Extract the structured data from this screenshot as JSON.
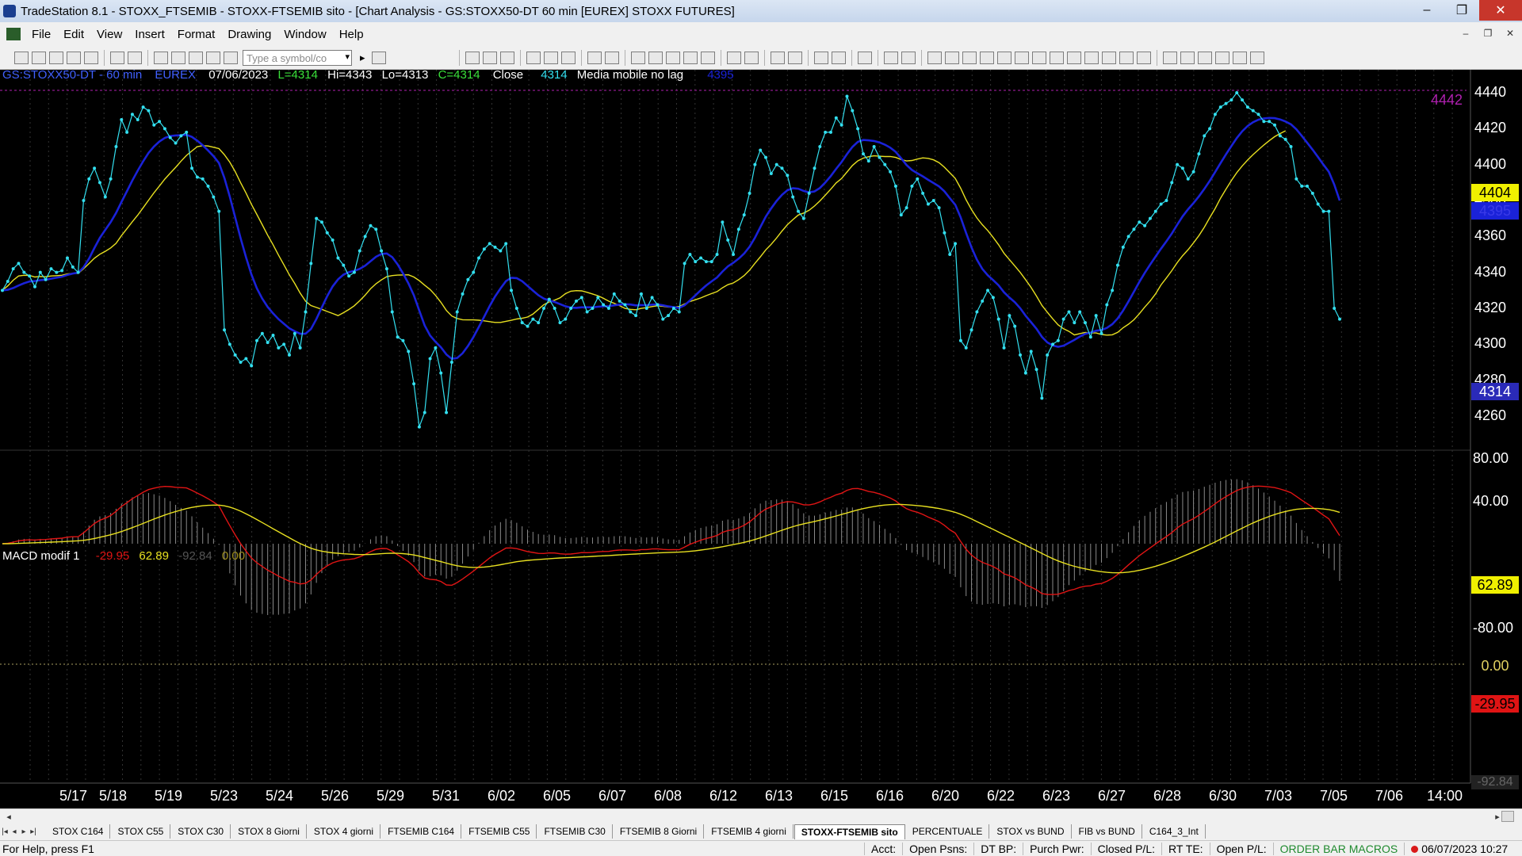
{
  "window": {
    "title": "TradeStation 8.1 - STOXX_FTSEMIB - STOXX-FTSEMIB sito - [Chart Analysis - GS:STOXX50-DT  60 min  [EUREX] STOXX FUTURES]",
    "minimize": "‒",
    "maximize": "❐",
    "close": "✕"
  },
  "menu": {
    "items": [
      "File",
      "Edit",
      "View",
      "Insert",
      "Format",
      "Drawing",
      "Window",
      "Help"
    ],
    "mdi_minimize": "–",
    "mdi_restore": "❐",
    "mdi_close": "✕"
  },
  "toolbar": {
    "symbol_placeholder": "Type a symbol/co",
    "symbol_dropdown": "▾",
    "symbol_go": "▸"
  },
  "chart": {
    "legend": {
      "symbol": "GS:STOXX50-DT - 60 min",
      "exchange": "EUREX",
      "date": "07/06/2023",
      "last": "L=4314",
      "high": "Hi=4343",
      "low": "Lo=4313",
      "close": "C=4314",
      "close_label": "Close",
      "close_value": "4314",
      "indicator": "Media mobile no lag",
      "indicator_value": "4395"
    },
    "macd_legend": {
      "name": "MACD modif 1",
      "v1": "-29.95",
      "v2": "62.89",
      "v3": "-92.84",
      "v4": "0.00"
    },
    "price_top_label": "4442",
    "price_axis": [
      "4440",
      "4420",
      "4400",
      "4380",
      "4360",
      "4340",
      "4320",
      "4300",
      "4280",
      "4260"
    ],
    "price_badges": {
      "yellow": "4404",
      "blue": "4395",
      "last": "4314"
    },
    "macd_axis": [
      "80.00",
      "40.00",
      "-40.00",
      "-80.00"
    ],
    "macd_badges": {
      "yellow": "62.89",
      "zero": "0.00",
      "red": "-29.95",
      "bottom": "-92.84"
    },
    "dates": [
      "5/17",
      "5/18",
      "5/19",
      "5/23",
      "5/24",
      "5/26",
      "5/29",
      "5/31",
      "6/02",
      "6/05",
      "6/07",
      "6/08",
      "6/12",
      "6/13",
      "6/15",
      "6/16",
      "6/20",
      "6/22",
      "6/23",
      "6/27",
      "6/28",
      "6/30",
      "7/03",
      "7/05",
      "7/06",
      "14:00"
    ],
    "colors": {
      "price": "#33e0f0",
      "slow_ma": "#e8e020",
      "fast_ma": "#1a22d8",
      "macd": "#e01414",
      "signal": "#e8e020",
      "histogram": "#8a8a8a"
    },
    "close_series": [
      4330,
      4335,
      4342,
      4345,
      4340,
      4338,
      4332,
      4340,
      4336,
      4342,
      4340,
      4341,
      4348,
      4343,
      4340,
      4380,
      4392,
      4398,
      4390,
      4382,
      4392,
      4410,
      4425,
      4418,
      4428,
      4425,
      4432,
      4430,
      4422,
      4424,
      4420,
      4415,
      4412,
      4416,
      4418,
      4398,
      4393,
      4392,
      4388,
      4382,
      4374,
      4308,
      4300,
      4294,
      4290,
      4292,
      4288,
      4302,
      4306,
      4301,
      4305,
      4298,
      4300,
      4294,
      4306,
      4298,
      4318,
      4345,
      4370,
      4368,
      4362,
      4358,
      4348,
      4344,
      4338,
      4340,
      4352,
      4360,
      4366,
      4364,
      4352,
      4342,
      4318,
      4304,
      4302,
      4296,
      4278,
      4254,
      4262,
      4292,
      4298,
      4284,
      4262,
      4290,
      4318,
      4328,
      4336,
      4340,
      4348,
      4353,
      4356,
      4354,
      4352,
      4356,
      4330,
      4320,
      4312,
      4310,
      4314,
      4312,
      4320,
      4325,
      4320,
      4312,
      4314,
      4320,
      4324,
      4326,
      4318,
      4320,
      4326,
      4322,
      4320,
      4328,
      4324,
      4322,
      4318,
      4316,
      4328,
      4320,
      4326,
      4322,
      4314,
      4316,
      4320,
      4318,
      4345,
      4350,
      4346,
      4348,
      4346,
      4346,
      4350,
      4368,
      4358,
      4350,
      4364,
      4372,
      4384,
      4400,
      4408,
      4404,
      4395,
      4400,
      4398,
      4394,
      4382,
      4374,
      4370,
      4384,
      4398,
      4410,
      4418,
      4418,
      4426,
      4422,
      4438,
      4430,
      4420,
      4406,
      4402,
      4410,
      4404,
      4400,
      4396,
      4388,
      4372,
      4376,
      4388,
      4392,
      4384,
      4378,
      4380,
      4376,
      4362,
      4350,
      4356,
      4302,
      4298,
      4308,
      4318,
      4324,
      4330,
      4326,
      4314,
      4298,
      4316,
      4310,
      4294,
      4284,
      4296,
      4286,
      4270,
      4294,
      4300,
      4302,
      4314,
      4318,
      4312,
      4318,
      4312,
      4304,
      4316,
      4306,
      4322,
      4330,
      4344,
      4354,
      4360,
      4364,
      4368,
      4366,
      4370,
      4374,
      4378,
      4380,
      4390,
      4400,
      4398,
      4392,
      4396,
      4406,
      4416,
      4420,
      4428,
      4432,
      4434,
      4436,
      4440,
      4436,
      4432,
      4430,
      4428,
      4424,
      4424,
      4422,
      4416,
      4414,
      4410,
      4392,
      4388,
      4388,
      4384,
      4378,
      4374,
      4374,
      4320,
      4314
    ]
  }
}
